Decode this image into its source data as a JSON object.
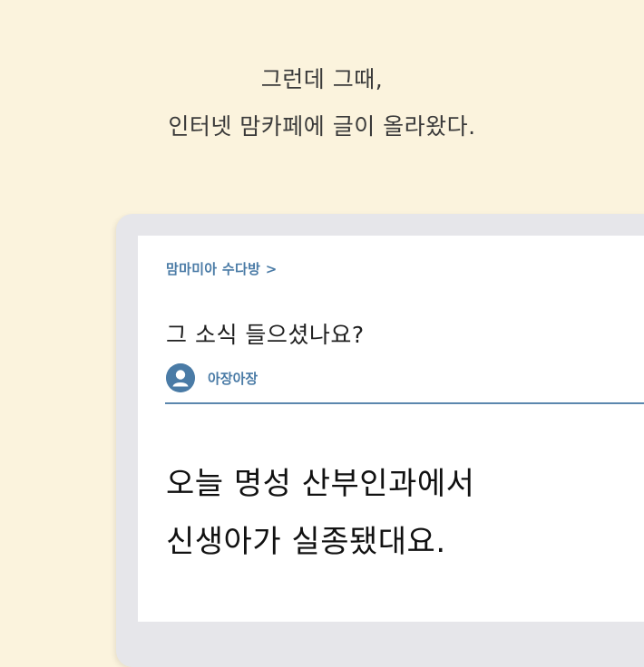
{
  "caption": {
    "line1": "그런데 그때,",
    "line2": "인터넷 맘카페에 글이 올라왔다."
  },
  "post": {
    "cafe_name": "맘마미아 수다방 >",
    "title": "그 소식 들으셨나요?",
    "author": "아장아장",
    "author_icon": "user-avatar-icon",
    "body_line1": "오늘 명성 산부인과에서",
    "body_line2": "신생아가 실종됐대요."
  },
  "colors": {
    "background": "#fbf3dd",
    "accent": "#4a7ba6",
    "device_frame": "#e6e6ea",
    "text": "#1f1f1f"
  }
}
